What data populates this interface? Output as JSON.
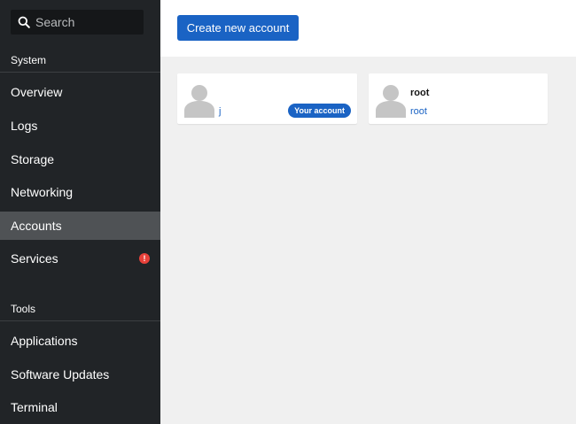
{
  "sidebar": {
    "search": {
      "placeholder": "Search",
      "icon": "search-icon"
    },
    "sections": [
      {
        "label": "System",
        "items": [
          {
            "label": "Overview"
          },
          {
            "label": "Logs"
          },
          {
            "label": "Storage"
          },
          {
            "label": "Networking"
          },
          {
            "label": "Accounts",
            "active": true
          },
          {
            "label": "Services",
            "alert": "!"
          }
        ]
      },
      {
        "label": "Tools",
        "items": [
          {
            "label": "Applications"
          },
          {
            "label": "Software Updates"
          },
          {
            "label": "Terminal"
          }
        ]
      }
    ]
  },
  "toolbar": {
    "create_label": "Create new account"
  },
  "accounts": [
    {
      "name": "",
      "login": "j",
      "badge": "Your account"
    },
    {
      "name": "root",
      "login": "root"
    }
  ],
  "colors": {
    "sidebar_bg": "#212427",
    "active_item_bg": "#4f5255",
    "accent": "#1a63c4",
    "alert": "#e8413a",
    "content_bg": "#f0f0f0"
  }
}
